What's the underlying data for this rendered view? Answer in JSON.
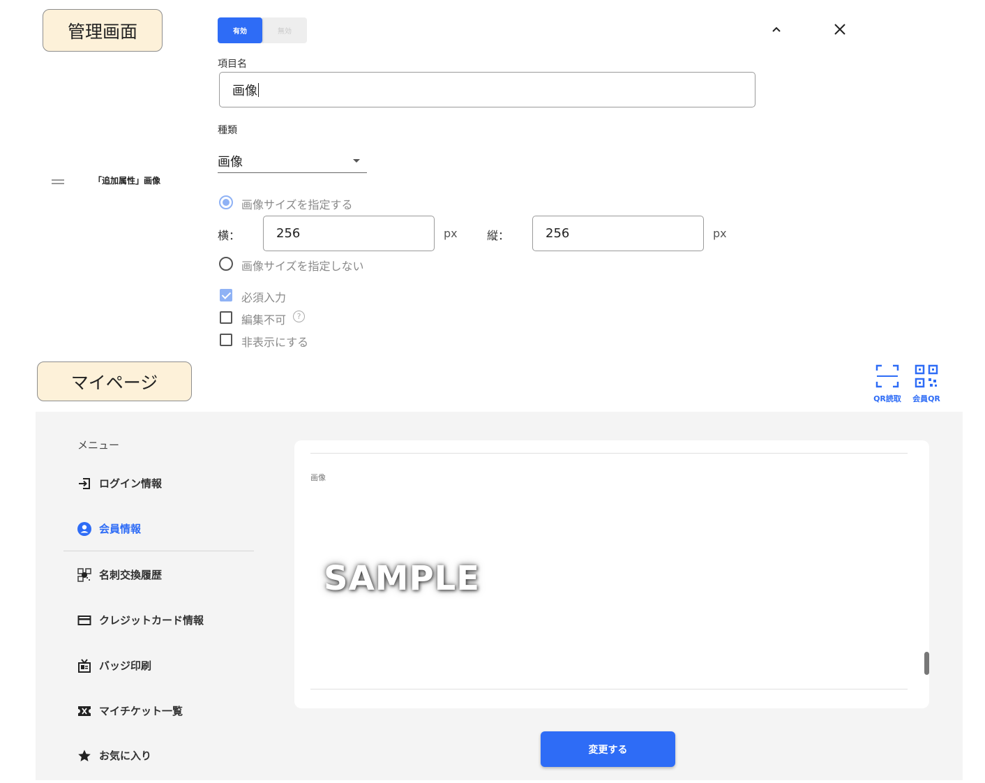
{
  "admin": {
    "section_label": "管理画面",
    "toggle": {
      "on_label": "有効",
      "off_label": "無効"
    },
    "collapse_icon": "chevron-up-icon",
    "close_icon": "close-icon",
    "item_name_label": "項目名",
    "item_name_value": "画像",
    "type_label": "種類",
    "type_value": "画像",
    "row_title": "「追加属性」画像",
    "size_specify_label": "画像サイズを指定する",
    "width_label": "横：",
    "width_value": "256",
    "height_label": "縦：",
    "height_value": "256",
    "unit": "px",
    "size_unspecified_label": "画像サイズを指定しない",
    "required_label": "必須入力",
    "readonly_label": "編集不可",
    "hidden_label": "非表示にする",
    "help_glyph": "?"
  },
  "mypage": {
    "section_label": "マイページ",
    "qr_scan_label": "QR読取",
    "member_qr_label": "会員QR",
    "menu_title": "メニュー",
    "menu": [
      {
        "label": "ログイン情報",
        "icon": "login-icon"
      },
      {
        "label": "会員情報",
        "icon": "account-circle-icon",
        "active": true
      },
      {
        "label": "名刺交換履歴",
        "icon": "card-exchange-icon"
      },
      {
        "label": "クレジットカード情報",
        "icon": "credit-card-icon"
      },
      {
        "label": "バッジ印刷",
        "icon": "badge-icon"
      },
      {
        "label": "マイチケット一覧",
        "icon": "ticket-icon"
      },
      {
        "label": "お気に入り",
        "icon": "star-icon"
      }
    ],
    "field_label": "画像",
    "sample_text": "SAMPLE",
    "submit_label": "変更する",
    "colors": {
      "accent": "#2e6cf6",
      "panel": "#f4f4f4",
      "label_bg": "#fdf1d9"
    }
  }
}
